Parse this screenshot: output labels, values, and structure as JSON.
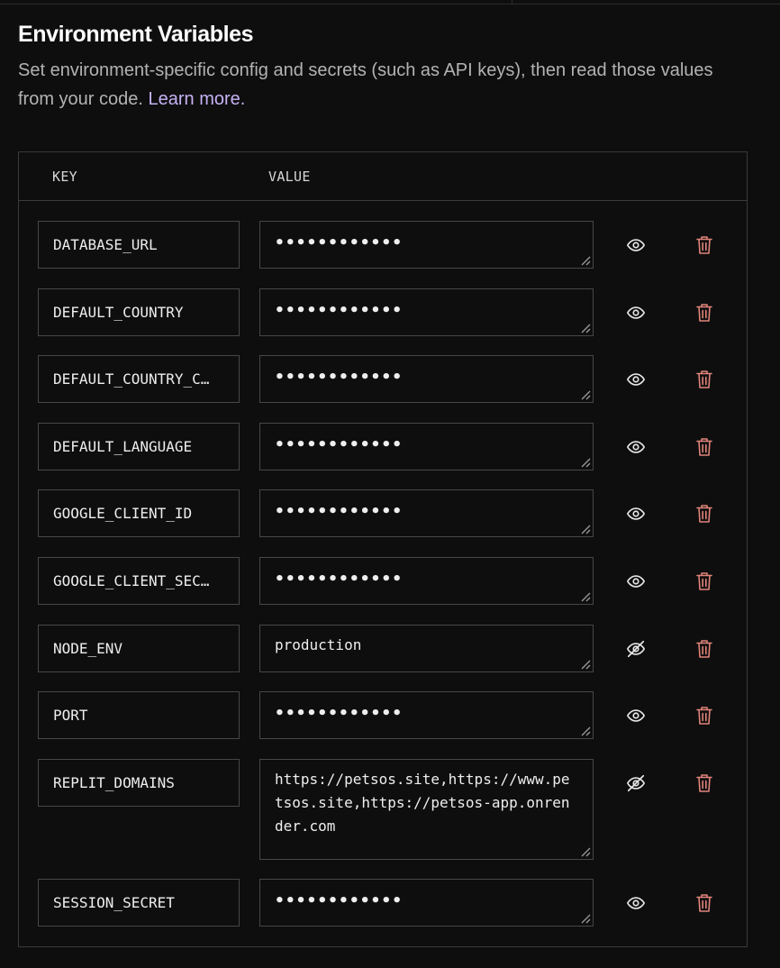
{
  "section": {
    "title": "Environment Variables",
    "description": "Set environment-specific config and secrets (such as API keys), then read those values from your code.",
    "learn_more_label": "Learn more."
  },
  "table": {
    "key_header": "KEY",
    "value_header": "VALUE"
  },
  "colors": {
    "background": "#0e0e0e",
    "border": "#474747",
    "link": "#c6b2f5",
    "delete_icon": "#e0847a"
  },
  "variables": [
    {
      "key": "DATABASE_URL",
      "value": "••••••••••••",
      "masked": true,
      "visibility_icon": "eye-icon",
      "delete_icon": "trash-icon"
    },
    {
      "key": "DEFAULT_COUNTRY",
      "value": "••••••••••••",
      "masked": true,
      "visibility_icon": "eye-icon",
      "delete_icon": "trash-icon"
    },
    {
      "key": "DEFAULT_COUNTRY_C…",
      "value": "••••••••••••",
      "masked": true,
      "visibility_icon": "eye-icon",
      "delete_icon": "trash-icon"
    },
    {
      "key": "DEFAULT_LANGUAGE",
      "value": "••••••••••••",
      "masked": true,
      "visibility_icon": "eye-icon",
      "delete_icon": "trash-icon"
    },
    {
      "key": "GOOGLE_CLIENT_ID",
      "value": "••••••••••••",
      "masked": true,
      "visibility_icon": "eye-icon",
      "delete_icon": "trash-icon"
    },
    {
      "key": "GOOGLE_CLIENT_SEC…",
      "value": "••••••••••••",
      "masked": true,
      "visibility_icon": "eye-icon",
      "delete_icon": "trash-icon"
    },
    {
      "key": "NODE_ENV",
      "value": "production",
      "masked": false,
      "visibility_icon": "eye-off-icon",
      "delete_icon": "trash-icon"
    },
    {
      "key": "PORT",
      "value": "••••••••••••",
      "masked": true,
      "visibility_icon": "eye-icon",
      "delete_icon": "trash-icon"
    },
    {
      "key": "REPLIT_DOMAINS",
      "value": "https://petsos.site,https://www.petsos.site,https://petsos-app.onrender.com",
      "masked": false,
      "visibility_icon": "eye-off-icon",
      "delete_icon": "trash-icon"
    },
    {
      "key": "SESSION_SECRET",
      "value": "••••••••••••",
      "masked": true,
      "visibility_icon": "eye-icon",
      "delete_icon": "trash-icon"
    }
  ]
}
